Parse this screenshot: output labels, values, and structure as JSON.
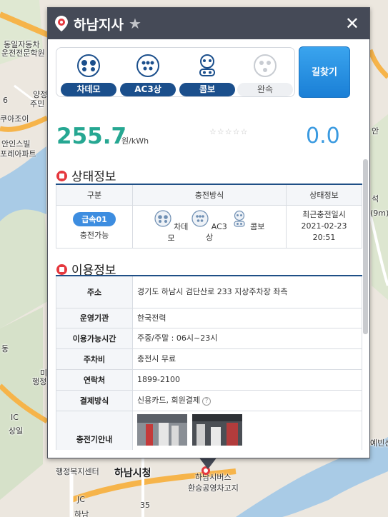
{
  "station": {
    "name": "하남지사",
    "route_label": "길찾기",
    "price": "255.7",
    "price_unit": "원/kWh",
    "rating": "0.0"
  },
  "connectors": [
    {
      "label": "차데모",
      "available": true
    },
    {
      "label": "AC3상",
      "available": true
    },
    {
      "label": "콤보",
      "available": true
    },
    {
      "label": "완속",
      "available": false
    }
  ],
  "status_section": {
    "title": "상태정보",
    "headers": [
      "구분",
      "충전방식",
      "상태정보"
    ],
    "row": {
      "badge": "급속01",
      "state": "충전가능",
      "types": [
        "차데모",
        "AC3상",
        "콤보"
      ],
      "status_label": "최근충전일시",
      "date": "2021-02-23",
      "time": "20:51"
    }
  },
  "info_section": {
    "title": "이용정보",
    "rows": [
      {
        "label": "주소",
        "value": "경기도 하남시 검단산로 233 지상주차장 좌측"
      },
      {
        "label": "운영기관",
        "value": "한국전력"
      },
      {
        "label": "이용가능시간",
        "value": "주중/주말 : 06시~23시"
      },
      {
        "label": "주차비",
        "value": "충전시 무료"
      },
      {
        "label": "연락처",
        "value": "1899-2100"
      },
      {
        "label": "결제방식",
        "value": "신용카드, 회원결제"
      },
      {
        "label": "충전기안내",
        "value": ""
      }
    ]
  },
  "map_labels": [
    "동일자동차",
    "운전전문학원",
    "양정",
    "주민",
    "쿠아조이",
    "안인스빌",
    "포레아파트",
    "하남시청",
    "행정복지센터",
    "상일",
    "하남시버스",
    "환승공영차고지",
    "예빈산",
    "(9m)",
    "6",
    "35",
    "JC",
    "IC",
    "동",
    "미",
    "행정",
    "안",
    "석",
    "하남"
  ],
  "colors": {
    "header": "#454a57",
    "accent_green": "#26a792",
    "accent_blue": "#3a9ae0",
    "badge_blue": "#1b4f8c",
    "section_red": "#e5383e"
  }
}
